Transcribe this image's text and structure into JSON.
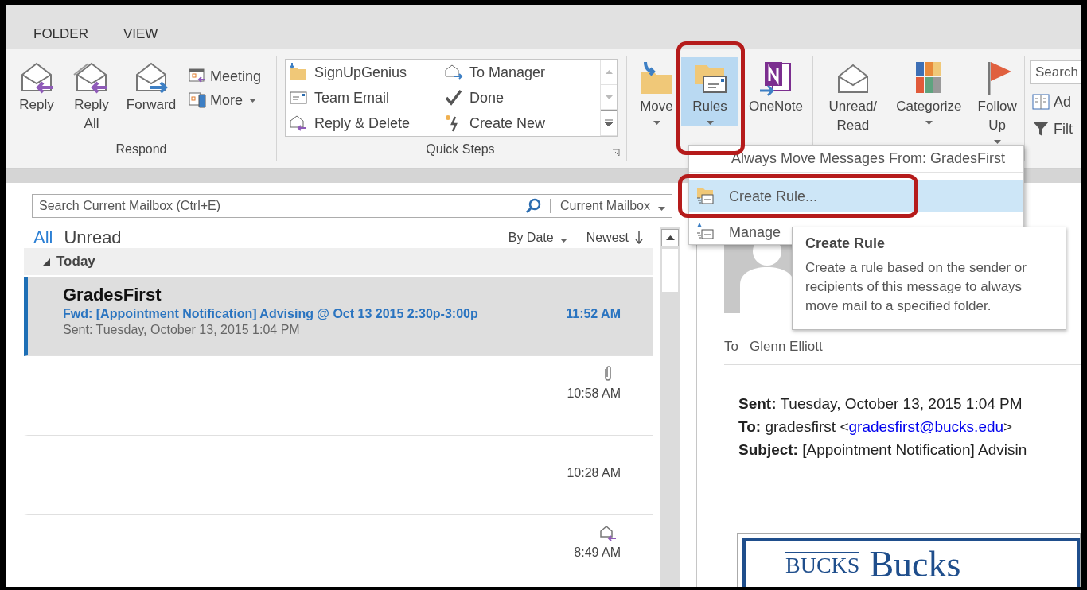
{
  "tabs": [
    {
      "label": "FOLDER",
      "selected": false
    },
    {
      "label": "VIEW",
      "selected": false
    }
  ],
  "ribbon": {
    "respond": {
      "label": "Respond",
      "large": [
        {
          "label": "Reply",
          "kind": "reply"
        },
        {
          "label": "Reply All",
          "kind": "reply-all"
        },
        {
          "label": "Forward",
          "kind": "forward"
        }
      ],
      "small": [
        {
          "label": "Meeting",
          "kind": "meeting",
          "dropdown": false
        },
        {
          "label": "More",
          "kind": "more",
          "dropdown": true
        }
      ]
    },
    "quick_steps": {
      "label": "Quick Steps",
      "items": [
        {
          "label": "SignUpGenius",
          "kind": "move-folder"
        },
        {
          "label": "To Manager",
          "kind": "forward-mail"
        },
        {
          "label": "Team Email",
          "kind": "email"
        },
        {
          "label": "Done",
          "kind": "check"
        },
        {
          "label": "Reply & Delete",
          "kind": "reply-mail"
        },
        {
          "label": "Create New",
          "kind": "new"
        }
      ]
    },
    "move": {
      "buttons": [
        {
          "label": "Move",
          "kind": "move",
          "dropdown": true,
          "selected": false,
          "highlighted": false
        },
        {
          "label": "Rules",
          "kind": "rules",
          "dropdown": true,
          "selected": true,
          "highlighted": true
        },
        {
          "label": "OneNote",
          "kind": "onenote",
          "dropdown": false,
          "selected": false,
          "highlighted": false
        }
      ]
    },
    "tags": {
      "buttons": [
        {
          "label": "Unread/ Read",
          "kind": "envelope",
          "dropdown": false
        },
        {
          "label": "Categorize",
          "kind": "categorize",
          "dropdown": true
        },
        {
          "label": "Follow Up",
          "kind": "flag",
          "dropdown": true
        }
      ]
    },
    "find": {
      "search_placeholder": "Search",
      "items": [
        {
          "label": "Ad",
          "kind": "address-book"
        },
        {
          "label": "Filt",
          "kind": "filter"
        }
      ]
    }
  },
  "rules_menu": {
    "items": [
      {
        "label": "Always Move Messages From: GradesFirst",
        "kind": "plain",
        "selected": false,
        "highlighted": false
      },
      {
        "label": "Create Rule...",
        "kind": "rule",
        "selected": true,
        "highlighted": true
      },
      {
        "label": "Manage",
        "kind": "rule-alert",
        "selected": false,
        "highlighted": false
      }
    ]
  },
  "tooltip": {
    "title": "Create Rule",
    "text": "Create a rule based on the sender or recipients of this message to always move mail to a specified folder."
  },
  "mail_list": {
    "search_placeholder": "Search Current Mailbox (Ctrl+E)",
    "scope": "Current Mailbox",
    "filters": [
      {
        "label": "All",
        "selected": true
      },
      {
        "label": "Unread",
        "selected": false
      }
    ],
    "sort": "By Date",
    "order": "Newest",
    "groups": [
      {
        "label": "Today",
        "expanded": true,
        "messages": [
          {
            "sender": "GradesFirst",
            "subject": "Fwd: [Appointment Notification] Advising @ Oct 13 2015 2:30p-3:00p",
            "preview": "Sent: Tuesday, October 13, 2015 1:04 PM",
            "time": "11:52 AM",
            "selected": true
          },
          {
            "time": "10:58 AM",
            "kind": "attachment",
            "selected": false
          },
          {
            "time": "10:28 AM",
            "kind": "plain",
            "selected": false
          },
          {
            "time": "8:49 AM",
            "kind": "replied",
            "selected": false
          }
        ]
      }
    ]
  },
  "reading_pane": {
    "to_label": "To",
    "to": "Glenn Elliott",
    "lines": [
      {
        "label": "Sent:",
        "text": "Tuesday, October 13, 2015 1:04 PM"
      },
      {
        "label": "To:",
        "text": "gradesfirst <",
        "link": "gradesfirst@bucks.edu",
        "after": ">"
      },
      {
        "label": "Subject:",
        "text": "[Appointment Notification] Advisin"
      }
    ],
    "logo": {
      "small": "BUCKS",
      "large": "Bucks"
    }
  }
}
